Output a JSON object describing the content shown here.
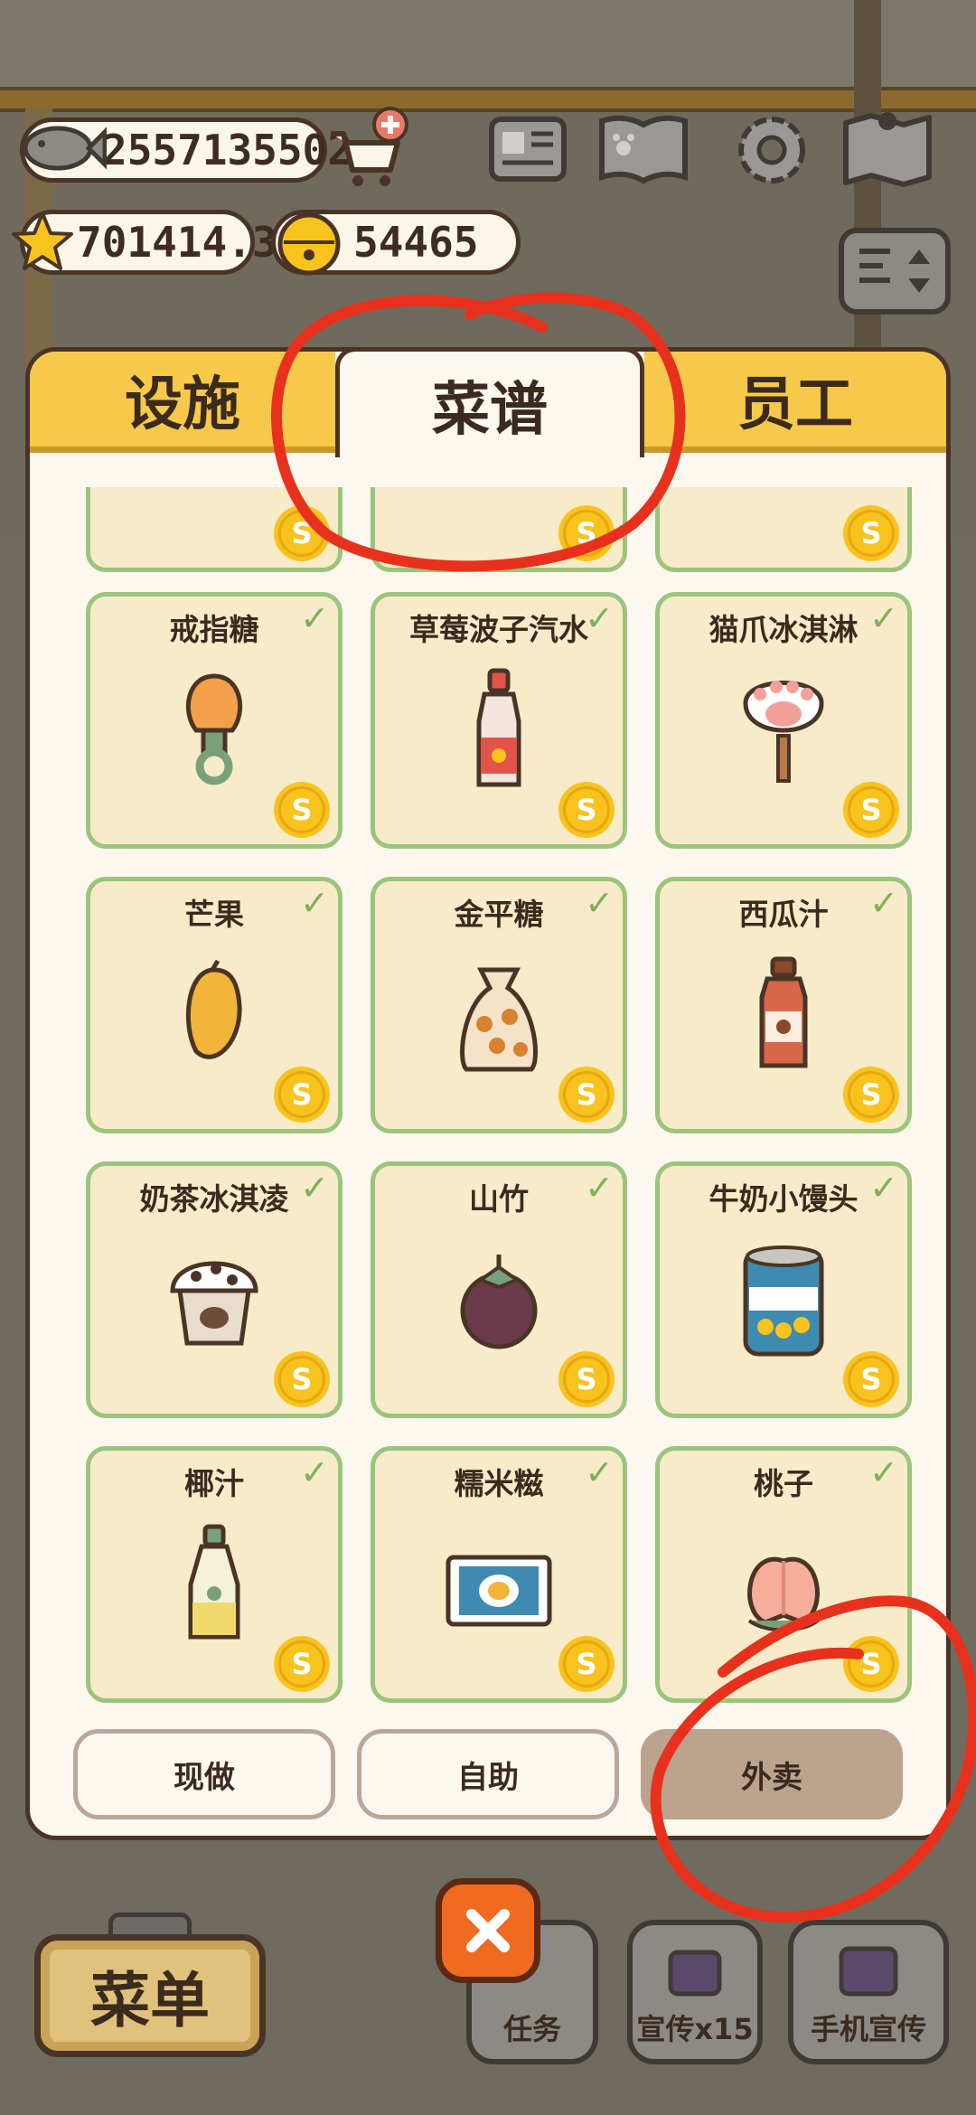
{
  "resources": {
    "fish": "2557135502",
    "stars": "701414.3",
    "bells": "54465"
  },
  "tabs": [
    {
      "label": "设施",
      "active": false
    },
    {
      "label": "菜谱",
      "active": true
    },
    {
      "label": "员工",
      "active": false
    }
  ],
  "recipes": [
    {
      "name": "戒指糖",
      "icon": "ring-candy-icon"
    },
    {
      "name": "草莓波子汽水",
      "icon": "strawberry-soda-icon"
    },
    {
      "name": "猫爪冰淇淋",
      "icon": "cat-paw-ice-cream-icon"
    },
    {
      "name": "芒果",
      "icon": "mango-icon"
    },
    {
      "name": "金平糖",
      "icon": "candy-bag-icon"
    },
    {
      "name": "西瓜汁",
      "icon": "watermelon-juice-icon"
    },
    {
      "name": "奶茶冰淇凌",
      "icon": "milk-tea-ice-cream-icon"
    },
    {
      "name": "山竹",
      "icon": "mangosteen-icon"
    },
    {
      "name": "牛奶小馒头",
      "icon": "milk-bun-can-icon"
    },
    {
      "name": "椰汁",
      "icon": "coconut-juice-icon"
    },
    {
      "name": "糯米糍",
      "icon": "mochi-pack-icon"
    },
    {
      "name": "桃子",
      "icon": "peach-icon"
    }
  ],
  "coin_symbol": "S",
  "check_symbol": "✓",
  "modes": [
    {
      "label": "现做",
      "selected": false
    },
    {
      "label": "自助",
      "selected": false
    },
    {
      "label": "外卖",
      "selected": true
    }
  ],
  "bottom": {
    "menu_label": "菜单",
    "task_label": "任务",
    "promo_label": "宣传x15",
    "phone_promo_label": "手机宣传"
  },
  "colors": {
    "tab_yellow": "#f7c94a",
    "card_bg": "#f7ebca",
    "card_border": "#9bc47c",
    "coin": "#f8c31d",
    "annotation_red": "#e8311c",
    "close_orange": "#f06a1f"
  }
}
